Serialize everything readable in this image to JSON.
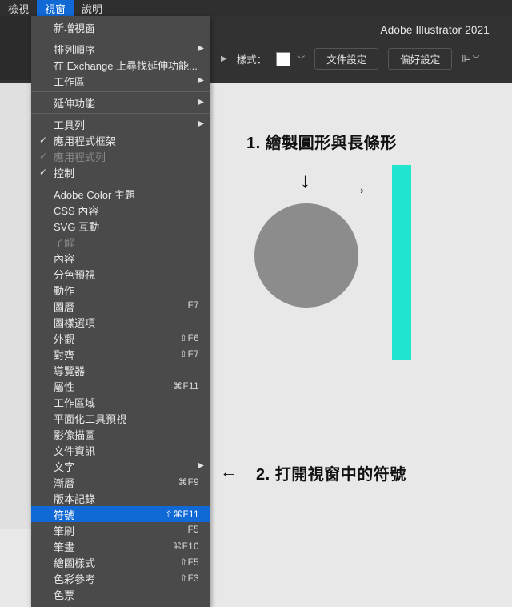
{
  "menubar": {
    "view": "檢視",
    "window": "視窗",
    "help": "說明"
  },
  "app_title": "Adobe Illustrator 2021",
  "toolbar": {
    "style_label": "樣式：",
    "doc_setup": "文件設定",
    "pref": "偏好設定"
  },
  "menu": {
    "new_window": "新增視窗",
    "arrange": "排列順序",
    "find_ext": "在 Exchange 上尋找延伸功能...",
    "workspace": "工作區",
    "extensions": "延伸功能",
    "toolbar": "工具列",
    "app_frame": "應用程式框架",
    "app_bar": "應用程式列",
    "control": "控制",
    "adobe_color": "Adobe Color 主題",
    "css_content": "CSS 內容",
    "svg_interact": "SVG 互動",
    "comprehend": "了解",
    "content": "內容",
    "sep_preview": "分色預視",
    "actions": "動作",
    "layers": "圖層",
    "layers_sc": "F7",
    "graphic_styles": "圖樣選項",
    "appearance": "外觀",
    "appearance_sc": "⇧F6",
    "align": "對齊",
    "align_sc": "⇧F7",
    "navigator": "導覽器",
    "attributes": "屬性",
    "attributes_sc": "⌘F11",
    "artboards": "工作區域",
    "flattener": "平面化工具預視",
    "image_trace": "影像描圖",
    "doc_info": "文件資訊",
    "type": "文字",
    "gradient": "漸層",
    "gradient_sc": "⌘F9",
    "version_history": "版本記錄",
    "symbols": "符號",
    "symbols_sc": "⇧⌘F11",
    "brushes": "筆刷",
    "brushes_sc": "F5",
    "pencil": "筆畫",
    "pencil_sc": "⌘F10",
    "paint_styles": "繪圖樣式",
    "paint_styles_sc": "⇧F5",
    "color_guide": "色彩參考",
    "color_guide_sc": "⇧F3",
    "swatches": "色票"
  },
  "annotations": {
    "step1": "1. 繪製圓形與長條形",
    "step2": "2. 打開視窗中的符號"
  }
}
